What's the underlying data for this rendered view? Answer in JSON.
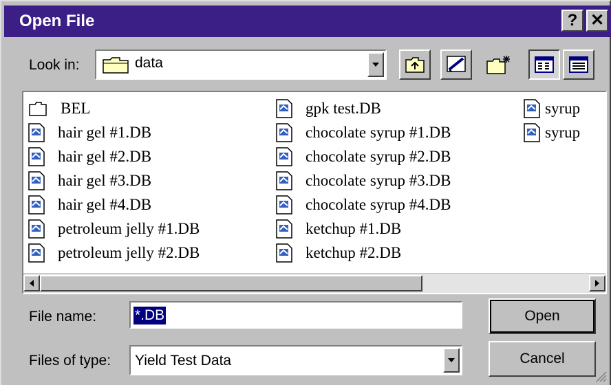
{
  "window": {
    "title": "Open File",
    "help_glyph": "?",
    "close_glyph": "✕"
  },
  "lookin": {
    "label": "Look in:",
    "value": "data",
    "icon": "folder-icon"
  },
  "toolbar": {
    "buttons": [
      "up-one-level-icon",
      "desktop-icon",
      "new-folder-icon",
      "list-view-icon",
      "details-view-icon"
    ]
  },
  "files": {
    "column1": [
      "BEL",
      "hair gel #1.DB",
      "hair gel #2.DB",
      "hair gel #3.DB",
      "hair gel #4.DB",
      "petroleum jelly #1.DB",
      "petroleum jelly #2.DB"
    ],
    "column2": [
      "gpk test.DB",
      "chocolate syrup #1.DB",
      "chocolate syrup #2.DB",
      "chocolate syrup #3.DB",
      "chocolate syrup #4.DB",
      "ketchup #1.DB",
      "ketchup #2.DB"
    ],
    "column3": [
      "syrup",
      "syrup"
    ]
  },
  "filename": {
    "label": "File name:",
    "value": "*.DB"
  },
  "filetype": {
    "label": "Files of type:",
    "value": "Yield Test Data"
  },
  "buttons": {
    "open": "Open",
    "cancel": "Cancel"
  }
}
